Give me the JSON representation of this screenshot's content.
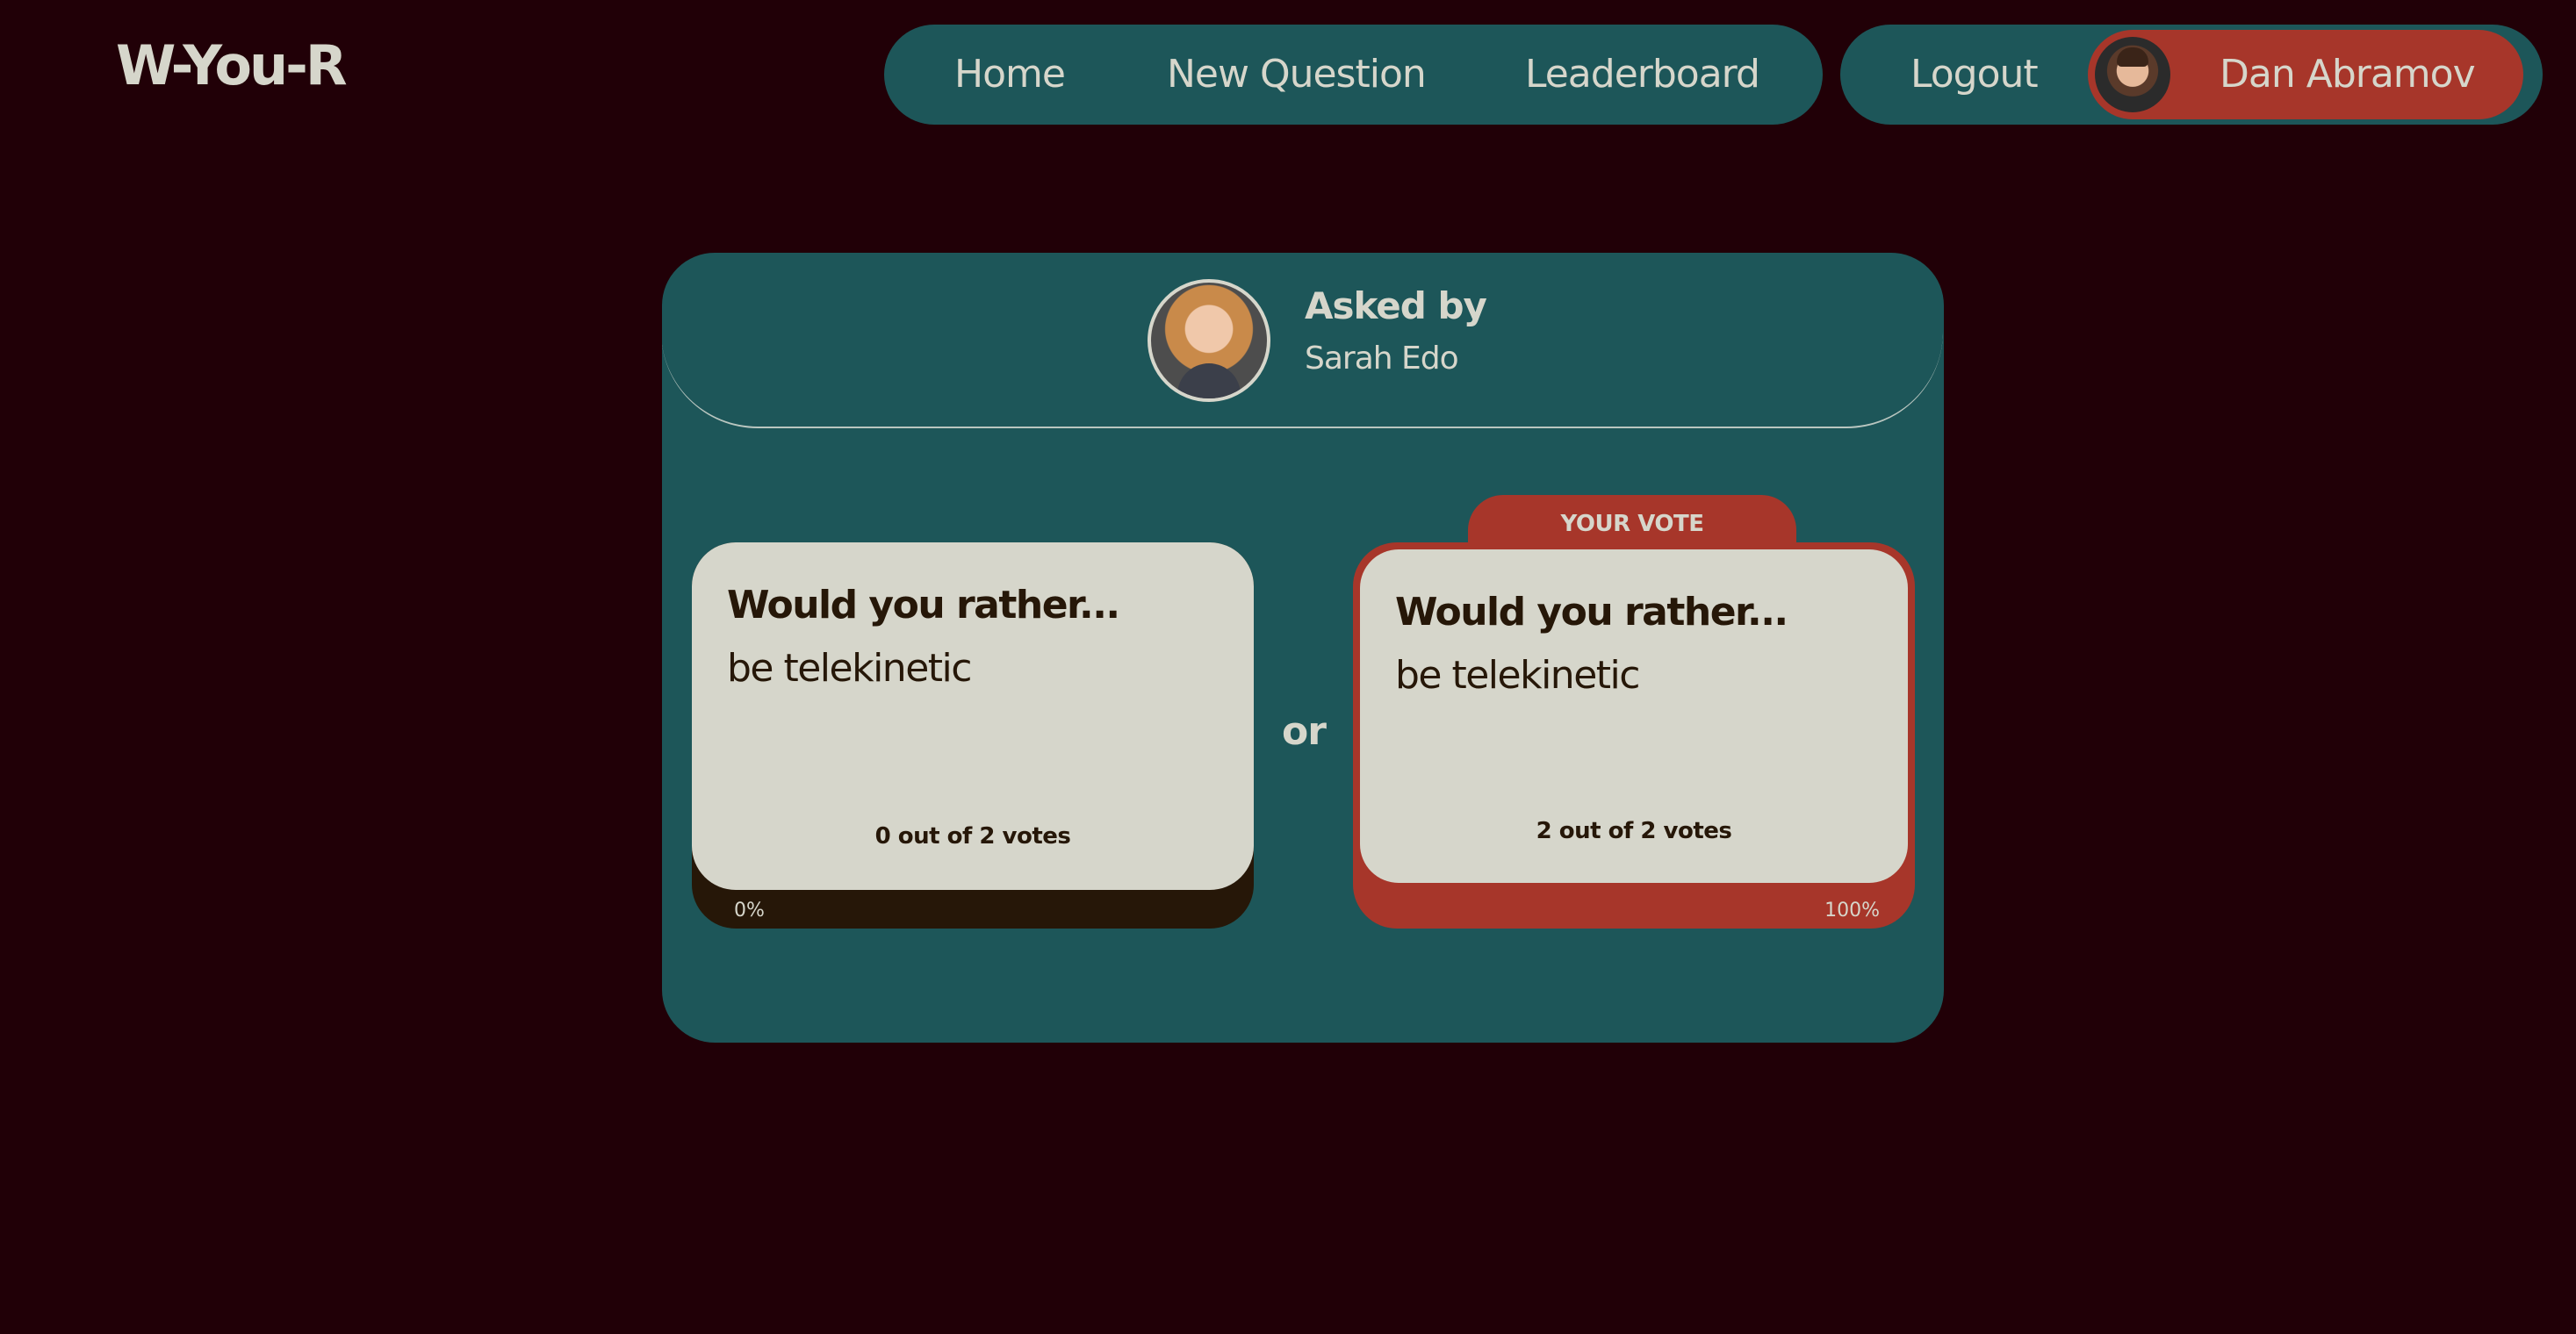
{
  "app": {
    "logo_text": "W-You-R"
  },
  "nav": {
    "items": [
      {
        "label": "Home"
      },
      {
        "label": "New Question"
      },
      {
        "label": "Leaderboard"
      }
    ]
  },
  "user_nav": {
    "logout_label": "Logout",
    "user_name": "Dan Abramov"
  },
  "question": {
    "asked_by_label": "Asked by",
    "author_name": "Sarah Edo",
    "or_label": "or",
    "your_vote_label": "YOUR VOTE",
    "options": [
      {
        "title": "Would you rather...",
        "text": "be telekinetic",
        "votes_text": "0 out of 2 votes",
        "percent_text": "0%",
        "percent": 0,
        "is_user_vote": false
      },
      {
        "title": "Would you rather...",
        "text": "be telekinetic",
        "votes_text": "2 out of 2 votes",
        "percent_text": "100%",
        "percent": 100,
        "is_user_vote": true
      }
    ]
  },
  "colors": {
    "background": "#210007",
    "panel": "#1d5659",
    "accent": "#a7362a",
    "text_light": "#d6d6cb",
    "text_dark": "#261708"
  }
}
